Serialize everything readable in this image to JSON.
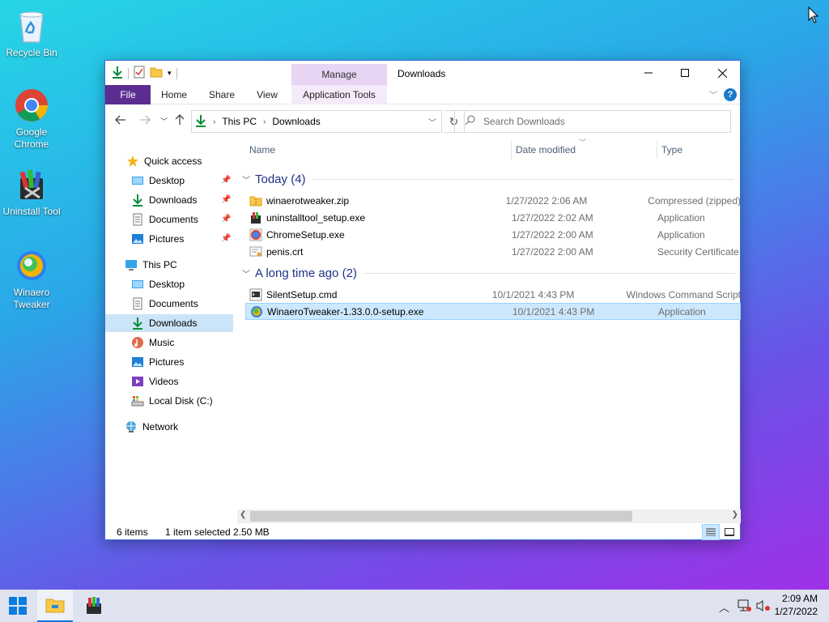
{
  "desktop": {
    "icons": [
      {
        "label": "Recycle Bin"
      },
      {
        "label": "Google Chrome"
      },
      {
        "label": "Uninstall Tool"
      },
      {
        "label": "Winaero Tweaker"
      }
    ]
  },
  "window": {
    "title": "Downloads",
    "manage_tab": "Manage",
    "ribbon_tabs": [
      "File",
      "Home",
      "Share",
      "View",
      "Application Tools"
    ],
    "help_label": "?",
    "address": {
      "crumbs": [
        "This PC",
        "Downloads"
      ]
    },
    "search": {
      "placeholder": "Search Downloads"
    },
    "nav": {
      "quick_access": "Quick access",
      "quick_items": [
        "Desktop",
        "Downloads",
        "Documents",
        "Pictures"
      ],
      "this_pc": "This PC",
      "pc_items": [
        "Desktop",
        "Documents",
        "Downloads",
        "Music",
        "Pictures",
        "Videos",
        "Local Disk (C:)"
      ],
      "network": "Network"
    },
    "columns": {
      "name": "Name",
      "date": "Date modified",
      "type": "Type"
    },
    "groups": [
      {
        "label": "Today (4)",
        "files": [
          {
            "name": "winaerotweaker.zip",
            "date": "1/27/2022 2:06 AM",
            "type": "Compressed (zipped)",
            "icon": "zip-folder-icon"
          },
          {
            "name": "uninstalltool_setup.exe",
            "date": "1/27/2022 2:02 AM",
            "type": "Application",
            "icon": "installer-icon"
          },
          {
            "name": "ChromeSetup.exe",
            "date": "1/27/2022 2:00 AM",
            "type": "Application",
            "icon": "chrome-setup-icon"
          },
          {
            "name": "penis.crt",
            "date": "1/27/2022 2:00 AM",
            "type": "Security Certificate",
            "icon": "certificate-icon"
          }
        ]
      },
      {
        "label": "A long time ago (2)",
        "files": [
          {
            "name": "SilentSetup.cmd",
            "date": "10/1/2021 4:43 PM",
            "type": "Windows Command Script",
            "icon": "cmd-script-icon"
          },
          {
            "name": "WinaeroTweaker-1.33.0.0-setup.exe",
            "date": "10/1/2021 4:43 PM",
            "type": "Application",
            "icon": "winaero-setup-icon",
            "selected": true
          }
        ]
      }
    ],
    "status": {
      "items": "6 items",
      "selected": "1 item selected",
      "size": "2.50 MB"
    }
  },
  "taskbar": {
    "time": "2:09 AM",
    "date": "1/27/2022"
  },
  "colors": {
    "file_tab": "#5c2d91",
    "selection": "#cce8ff",
    "group_text": "#1e3287"
  }
}
